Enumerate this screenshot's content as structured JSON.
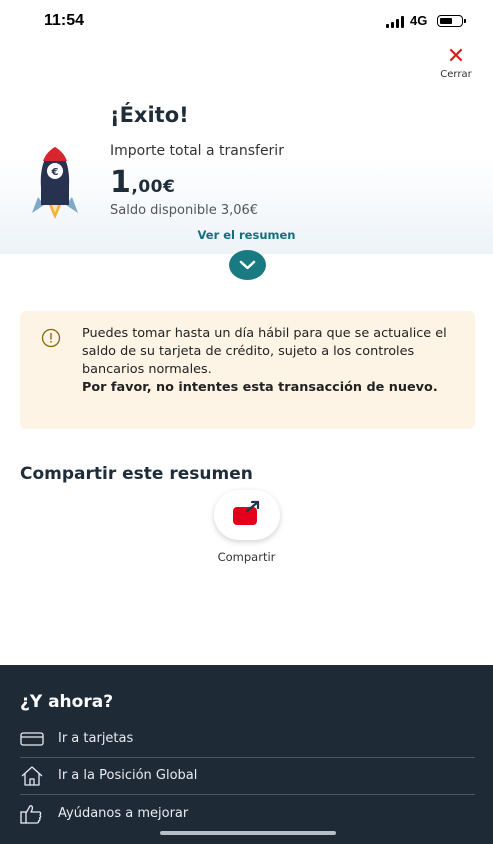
{
  "status_bar": {
    "time": "11:54",
    "network": "4G"
  },
  "close": {
    "label": "Cerrar"
  },
  "success": {
    "title": "¡Éxito!",
    "amount_label": "Importe total a transferir",
    "amount_integer": "1",
    "amount_decimal": ",00€",
    "balance_text": "Saldo disponible 3,06€",
    "summary_link": "Ver el resumen"
  },
  "notice": {
    "text": "Puedes tomar hasta un día hábil para que se actualice el saldo de su tarjeta de crédito, sujeto a los controles bancarios normales.",
    "bold_text": "Por favor, no intentes esta transacción de nuevo."
  },
  "share": {
    "title": "Compartir este resumen",
    "button_label": "Compartir"
  },
  "next_steps": {
    "title": "¿Y ahora?",
    "items": [
      {
        "label": "Ir a tarjetas",
        "icon": "card-icon"
      },
      {
        "label": "Ir a la Posición Global",
        "icon": "home-icon"
      },
      {
        "label": "Ayúdanos a mejorar",
        "icon": "thumbs-up-icon"
      }
    ]
  },
  "colors": {
    "accent": "#1a7a82",
    "close": "#d3211b",
    "notice_bg": "#fdf4e6",
    "footer_bg": "#1f2a37",
    "brand_red": "#e3001b"
  }
}
